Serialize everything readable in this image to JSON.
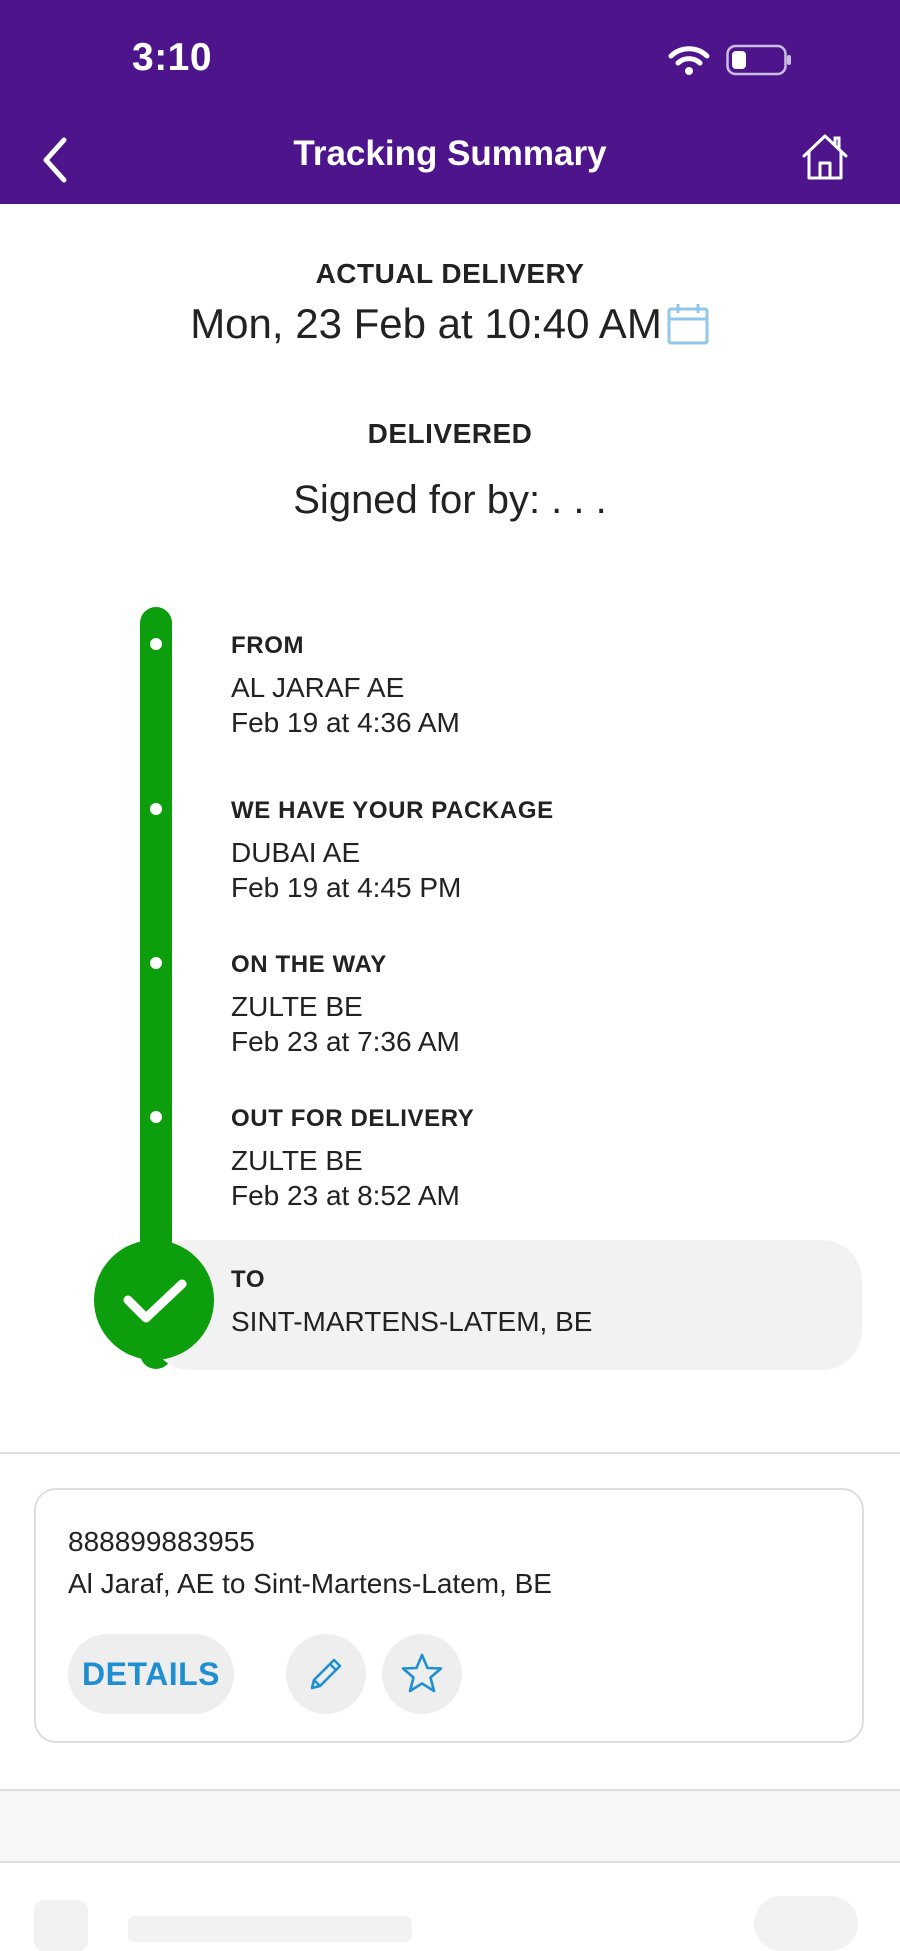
{
  "status_bar": {
    "time": "3:10"
  },
  "header": {
    "title": "Tracking Summary"
  },
  "delivery": {
    "actual_label": "ACTUAL DELIVERY",
    "actual_date": "Mon, 23 Feb at 10:40 AM",
    "status_label": "DELIVERED",
    "signed_text": "Signed for by: . . ."
  },
  "timeline": [
    {
      "title": "FROM",
      "location": "AL JARAF AE",
      "time": "Feb 19 at 4:36 AM"
    },
    {
      "title": "WE HAVE YOUR PACKAGE",
      "location": "DUBAI AE",
      "time": "Feb 19 at 4:45 PM"
    },
    {
      "title": "ON THE WAY",
      "location": "ZULTE BE",
      "time": "Feb 23 at 7:36 AM"
    },
    {
      "title": "OUT FOR DELIVERY",
      "location": "ZULTE BE",
      "time": "Feb 23 at 8:52 AM"
    },
    {
      "title": "TO",
      "location": "SINT-MARTENS-LATEM, BE"
    }
  ],
  "shipment": {
    "tracking_number": "888899883955",
    "route": "Al Jaraf, AE to Sint-Martens-Latem, BE",
    "details_label": "DETAILS"
  },
  "colors": {
    "header_bg": "#4d148c",
    "progress_green": "#0c9e0c",
    "link_blue": "#1f8fd2"
  },
  "icons": [
    "wifi-icon",
    "battery-icon",
    "back-chevron-icon",
    "home-icon",
    "calendar-icon",
    "checkmark-icon",
    "pencil-icon",
    "star-icon"
  ]
}
